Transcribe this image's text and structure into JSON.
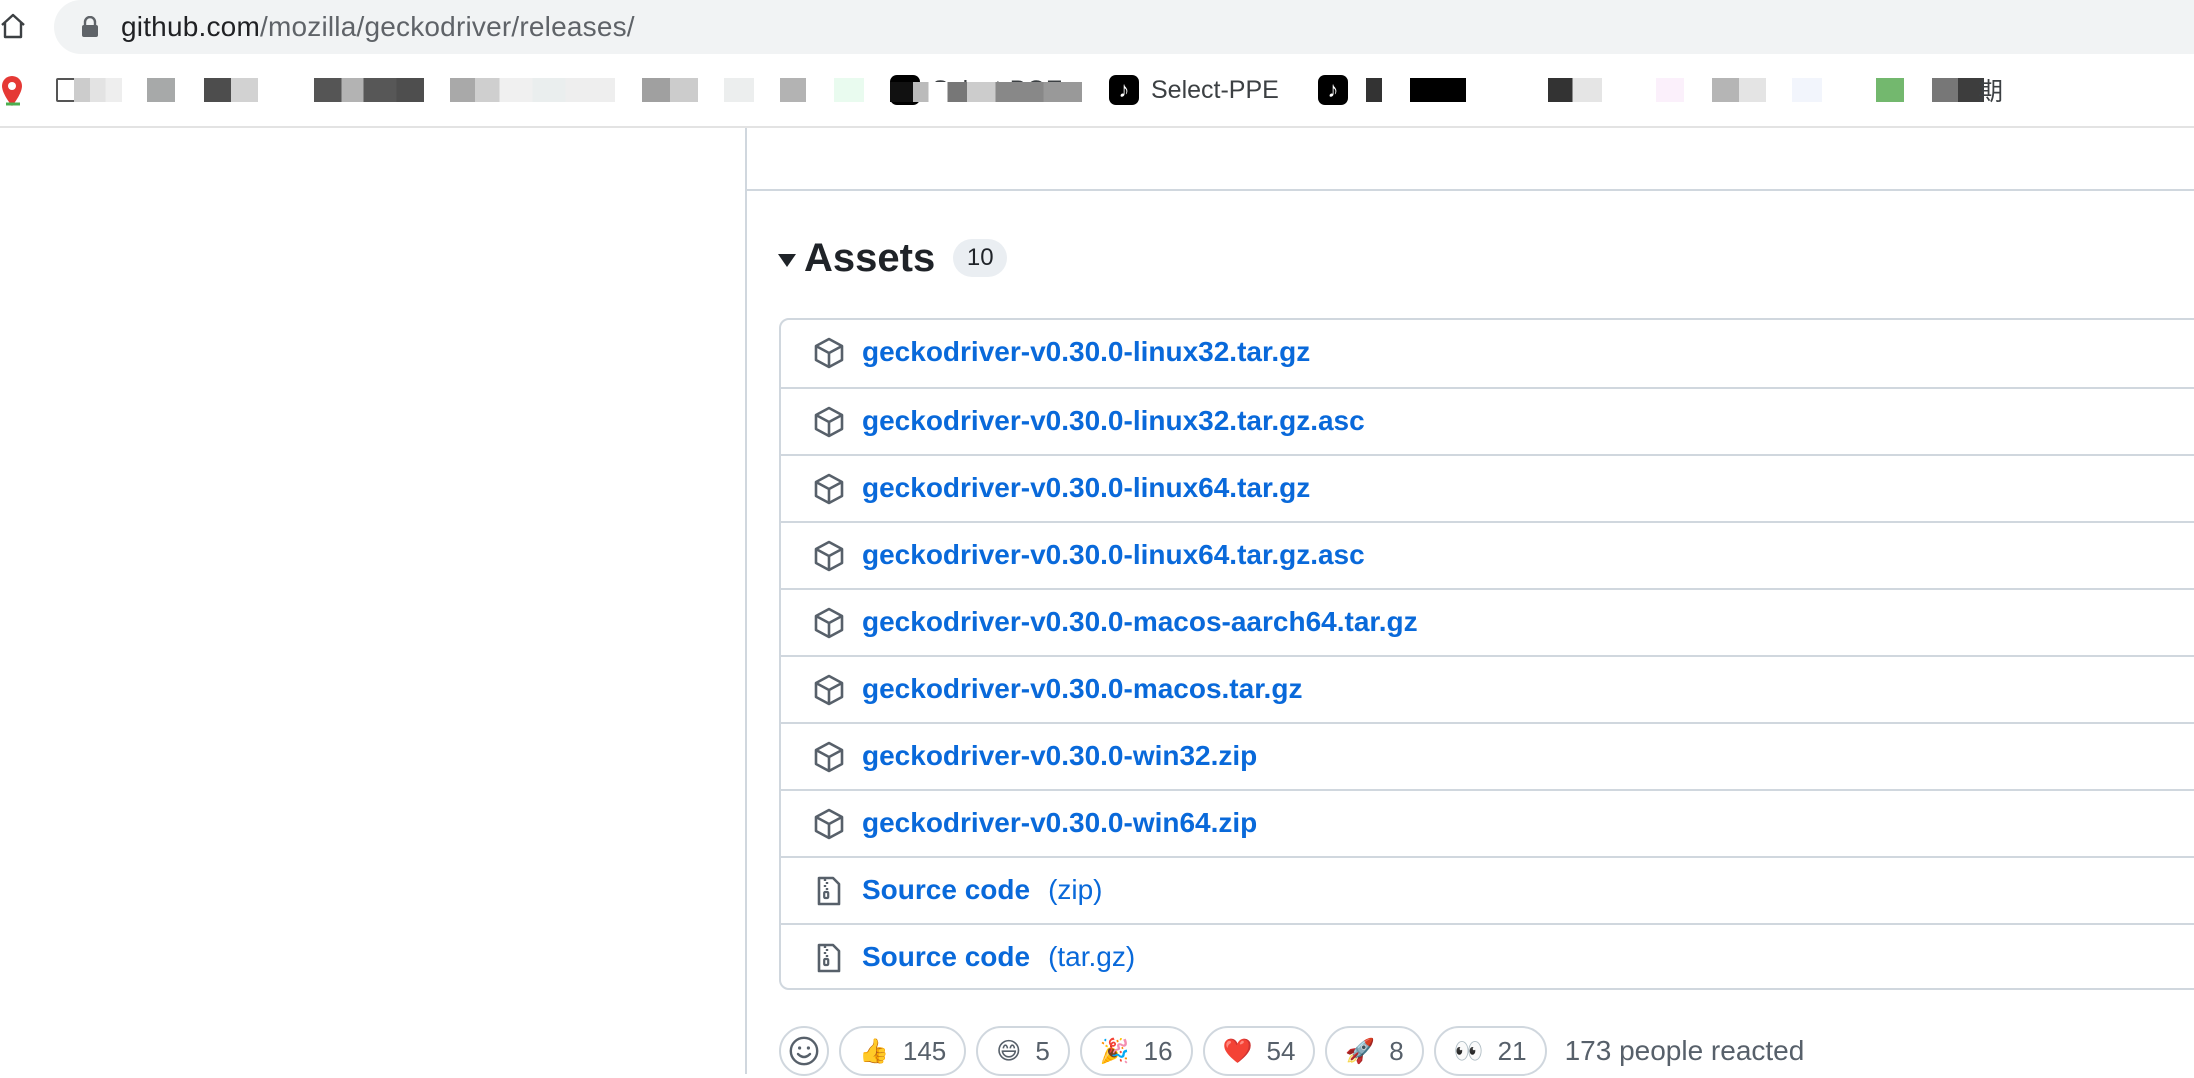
{
  "browser": {
    "url_host": "github.com",
    "url_path": "/mozilla/geckodriver/releases/",
    "bookmarks": [
      {
        "label": "Select-BOE"
      },
      {
        "label": "Select-PPE"
      },
      {
        "label": "期"
      }
    ]
  },
  "assets": {
    "title": "Assets",
    "count": "10",
    "items": [
      {
        "name": "geckodriver-v0.30.0-linux32.tar.gz",
        "suffix": "",
        "icon": "package-icon"
      },
      {
        "name": "geckodriver-v0.30.0-linux32.tar.gz.asc",
        "suffix": "",
        "icon": "package-icon"
      },
      {
        "name": "geckodriver-v0.30.0-linux64.tar.gz",
        "suffix": "",
        "icon": "package-icon"
      },
      {
        "name": "geckodriver-v0.30.0-linux64.tar.gz.asc",
        "suffix": "",
        "icon": "package-icon"
      },
      {
        "name": "geckodriver-v0.30.0-macos-aarch64.tar.gz",
        "suffix": "",
        "icon": "package-icon"
      },
      {
        "name": "geckodriver-v0.30.0-macos.tar.gz",
        "suffix": "",
        "icon": "package-icon"
      },
      {
        "name": "geckodriver-v0.30.0-win32.zip",
        "suffix": "",
        "icon": "package-icon"
      },
      {
        "name": "geckodriver-v0.30.0-win64.zip",
        "suffix": "",
        "icon": "package-icon"
      },
      {
        "name": "Source code",
        "suffix": "(zip)",
        "icon": "file-zip-icon"
      },
      {
        "name": "Source code",
        "suffix": "(tar.gz)",
        "icon": "file-zip-icon"
      }
    ]
  },
  "reactions": {
    "items": [
      {
        "emoji": "👍",
        "count": "145",
        "name": "thumbs-up"
      },
      {
        "emoji": "😄",
        "count": "5",
        "name": "laugh"
      },
      {
        "emoji": "🎉",
        "count": "16",
        "name": "hooray"
      },
      {
        "emoji": "❤️",
        "count": "54",
        "name": "heart"
      },
      {
        "emoji": "🚀",
        "count": "8",
        "name": "rocket"
      },
      {
        "emoji": "👀",
        "count": "21",
        "name": "eyes"
      }
    ],
    "summary": "173 people reacted"
  },
  "colors": {
    "link": "#0969da",
    "border": "#d0d7de",
    "muted": "#57606a"
  }
}
